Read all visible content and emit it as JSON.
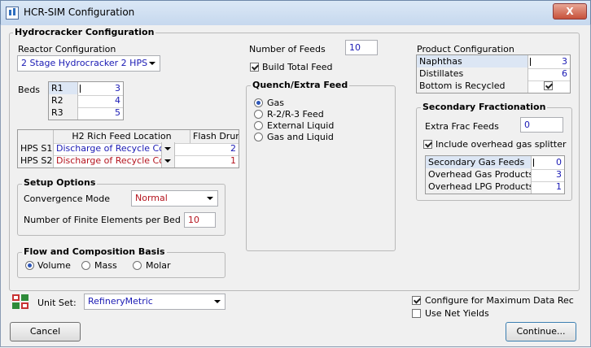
{
  "window": {
    "title": "HCR-SIM Configuration",
    "close_glyph": "X"
  },
  "hydrocracker": {
    "group_title": "Hydrocracker Configuration",
    "reactor_label": "Reactor Configuration",
    "reactor_value": "2 Stage Hydrocracker 2 HPS",
    "beds_label": "Beds",
    "beds": [
      {
        "name": "R1",
        "value": "3"
      },
      {
        "name": "R2",
        "value": "4"
      },
      {
        "name": "R3",
        "value": "5"
      }
    ],
    "h2_table": {
      "headers": [
        "H2 Rich Feed Location",
        "Flash Drums"
      ],
      "rows": [
        {
          "name": "HPS S1",
          "location": "Discharge of Recycle Co",
          "drums": "2"
        },
        {
          "name": "HPS S2",
          "location": "Discharge of Recycle Co",
          "drums": "1"
        }
      ]
    },
    "setup": {
      "title": "Setup Options",
      "convergence_label": "Convergence Mode",
      "convergence_value": "Normal",
      "finite_label": "Number of Finite Elements per Bed",
      "finite_value": "10"
    },
    "basis": {
      "title": "Flow and Composition Basis",
      "options": [
        "Volume",
        "Mass",
        "Molar"
      ],
      "selected": "Volume"
    }
  },
  "feeds": {
    "number_label": "Number of Feeds",
    "number_value": "10",
    "build_total_label": "Build Total Feed",
    "quench_title": "Quench/Extra Feed",
    "quench_options": [
      "Gas",
      "R-2/R-3 Feed",
      "External Liquid",
      "Gas and Liquid"
    ],
    "quench_selected": "Gas"
  },
  "product": {
    "title": "Product Configuration",
    "rows": [
      {
        "name": "Naphthas",
        "value": "3"
      },
      {
        "name": "Distillates",
        "value": "6"
      },
      {
        "name": "Bottom is Recycled",
        "value": ""
      }
    ]
  },
  "secondary": {
    "title": "Secondary Fractionation",
    "extra_label": "Extra Frac Feeds",
    "extra_value": "0",
    "splitter_label": "Include overhead gas splitter",
    "rows": [
      {
        "name": "Secondary Gas Feeds",
        "value": "0"
      },
      {
        "name": "Overhead Gas Products",
        "value": "3"
      },
      {
        "name": "Overhead LPG Products",
        "value": "1"
      }
    ]
  },
  "unitset": {
    "label": "Unit Set:",
    "value": "RefineryMetric",
    "icon": "unit-set-icon"
  },
  "options": {
    "max_data_label": "Configure for Maximum Data Rec",
    "net_yields_label": "Use Net Yields"
  },
  "buttons": {
    "cancel": "Cancel",
    "continue": "Continue..."
  },
  "colors": {
    "value_blue": "#1a1ab4",
    "value_red": "#b4141e"
  }
}
